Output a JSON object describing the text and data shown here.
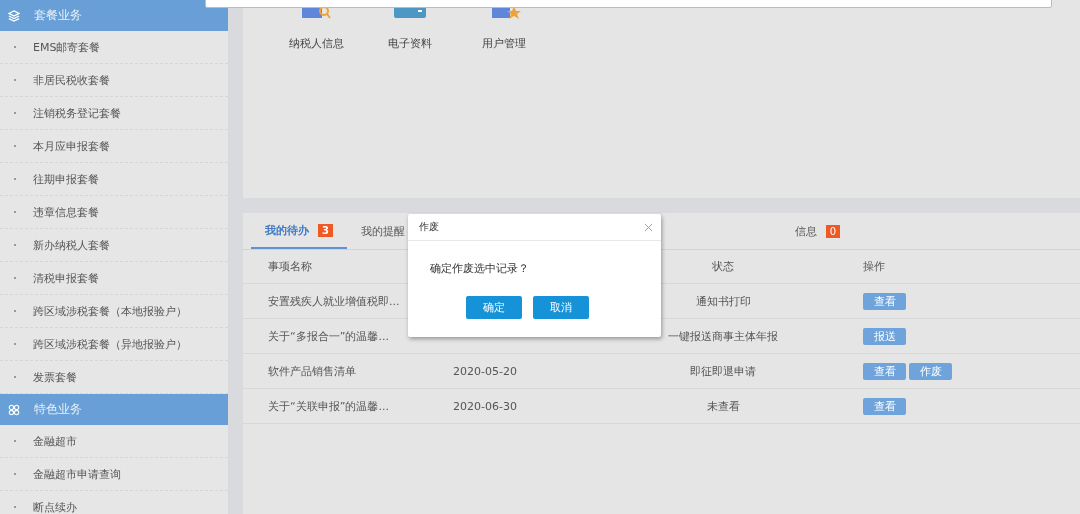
{
  "sidebar": {
    "groups": [
      {
        "title": "套餐业务",
        "items": [
          {
            "label": "EMS邮寄套餐"
          },
          {
            "label": "非居民税收套餐"
          },
          {
            "label": "注销税务登记套餐"
          },
          {
            "label": "本月应申报套餐"
          },
          {
            "label": "往期申报套餐"
          },
          {
            "label": "违章信息套餐"
          },
          {
            "label": "新办纳税人套餐"
          },
          {
            "label": "清税申报套餐"
          },
          {
            "label": "跨区域涉税套餐（本地报验户）"
          },
          {
            "label": "跨区域涉税套餐（异地报验户）"
          },
          {
            "label": "发票套餐"
          }
        ]
      },
      {
        "title": "特色业务",
        "items": [
          {
            "label": "金融超市"
          },
          {
            "label": "金融超市申请查询"
          },
          {
            "label": "断点续办"
          }
        ]
      }
    ]
  },
  "shortcuts": [
    {
      "label": "纳税人信息"
    },
    {
      "label": "电子资料"
    },
    {
      "label": "用户管理"
    }
  ],
  "tabs": [
    {
      "label": "我的待办",
      "badge": "3",
      "selected": true
    },
    {
      "label": "我的提醒",
      "selected": false
    },
    {
      "label": "信息",
      "badge": "0",
      "selected": false
    }
  ],
  "table": {
    "columns": [
      "事项名称",
      "",
      "状态",
      "操作"
    ],
    "rows": [
      {
        "name": "安置残疾人就业增值税即...",
        "status": "通知书打印",
        "actions": [
          "查看"
        ]
      },
      {
        "name": "关于“多报合一”的温馨...",
        "status": "一键报送商事主体年报",
        "actions": [
          "报送"
        ]
      },
      {
        "name": "软件产品销售清单",
        "date": "2020-05-20",
        "status": "即征即退申请",
        "actions": [
          "查看",
          "作废"
        ]
      },
      {
        "name": "关于“关联申报”的温馨...",
        "date": "2020-06-30",
        "status": "未查看",
        "actions": [
          "查看"
        ]
      }
    ]
  },
  "dialog": {
    "title": "作废",
    "message": "确定作废选中记录？",
    "buttons": [
      "确定",
      "取消"
    ]
  }
}
